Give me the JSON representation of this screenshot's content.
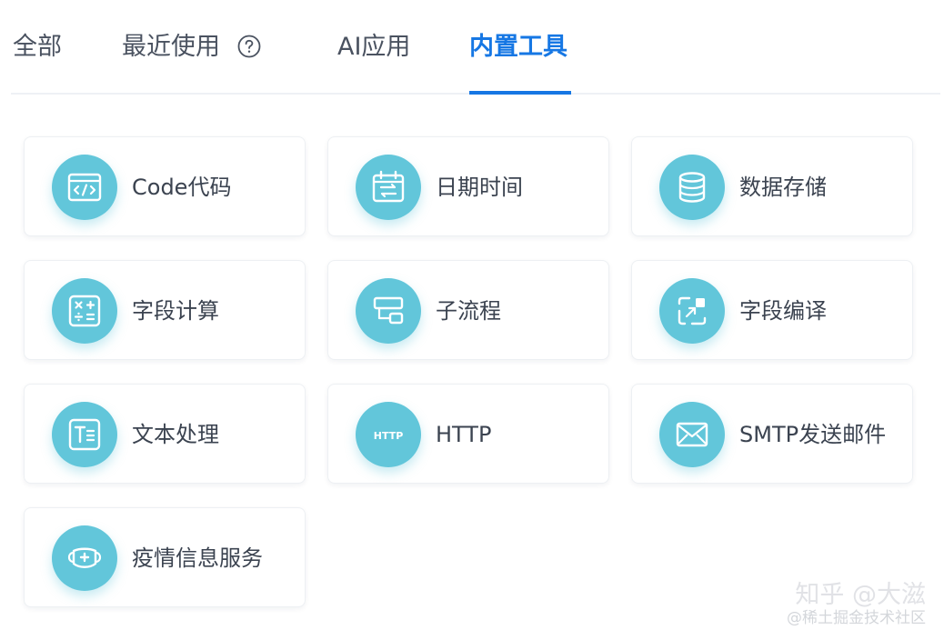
{
  "tabs": [
    {
      "label": "全部"
    },
    {
      "label": "最近使用"
    },
    {
      "label": "AI应用"
    },
    {
      "label": "内置工具"
    }
  ],
  "active_tab": "内置工具",
  "cards": [
    {
      "label": "Code代码",
      "icon": "code-icon"
    },
    {
      "label": "日期时间",
      "icon": "calendar-icon"
    },
    {
      "label": "数据存储",
      "icon": "database-icon"
    },
    {
      "label": "字段计算",
      "icon": "calculator-icon"
    },
    {
      "label": "子流程",
      "icon": "subflow-icon"
    },
    {
      "label": "字段编译",
      "icon": "field-compile-icon"
    },
    {
      "label": "文本处理",
      "icon": "text-icon"
    },
    {
      "label": "HTTP",
      "icon": "http-icon",
      "icon_text": "HTTP"
    },
    {
      "label": "SMTP发送邮件",
      "icon": "mail-icon"
    },
    {
      "label": "疫情信息服务",
      "icon": "mask-icon"
    }
  ],
  "watermark": {
    "line1": "知乎 @大滋",
    "line2": "@稀土掘金技术社区"
  },
  "colors": {
    "accent": "#1677e4",
    "icon_bg": "#62c6da",
    "text": "#3b4350"
  }
}
